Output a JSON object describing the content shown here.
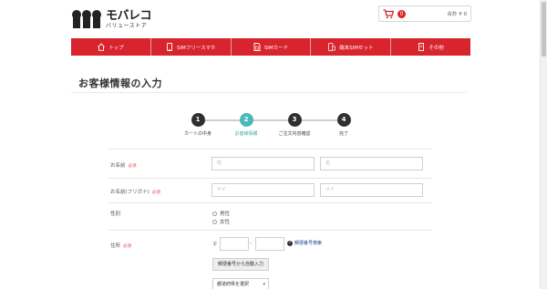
{
  "header": {
    "logo_main": "モバレコ",
    "logo_sub": "バリューストア",
    "cart_count": "0",
    "cart_total": "合計 ¥ 0"
  },
  "nav": {
    "items": [
      {
        "label": "トップ",
        "icon": "home-icon"
      },
      {
        "label": "SIMフリースマホ",
        "icon": "smartphone-icon"
      },
      {
        "label": "SIMカード",
        "icon": "sim-card-icon"
      },
      {
        "label": "端末SIMセット",
        "icon": "phone-sim-set-icon"
      },
      {
        "label": "その他",
        "icon": "document-icon"
      }
    ]
  },
  "page": {
    "title": "お客様情報の入力"
  },
  "steps": [
    {
      "number": "1",
      "label": "カートの中身",
      "active": false
    },
    {
      "number": "2",
      "label": "お客様情報",
      "active": true
    },
    {
      "number": "3",
      "label": "ご注文内容確認",
      "active": false
    },
    {
      "number": "4",
      "label": "完了",
      "active": false
    }
  ],
  "form": {
    "name": {
      "label": "お名前",
      "required": "必須",
      "last_placeholder": "姓",
      "first_placeholder": "名"
    },
    "kana": {
      "label": "お名前(フリガナ)",
      "required": "必須",
      "last_placeholder": "セイ",
      "first_placeholder": "メイ"
    },
    "gender": {
      "label": "性別",
      "options": [
        "男性",
        "女性"
      ]
    },
    "address": {
      "label": "住所",
      "required": "必須",
      "zip_mark": "〒",
      "zip_dash": "-",
      "zip_search": "郵便番号検索",
      "auto_fill_button": "郵便番号から自動入力",
      "prefecture_select": "都道府県を選択"
    }
  },
  "colors": {
    "brand_red": "#d7242d",
    "step_active": "#49b8b9",
    "step_inactive": "#2f2f2f"
  }
}
